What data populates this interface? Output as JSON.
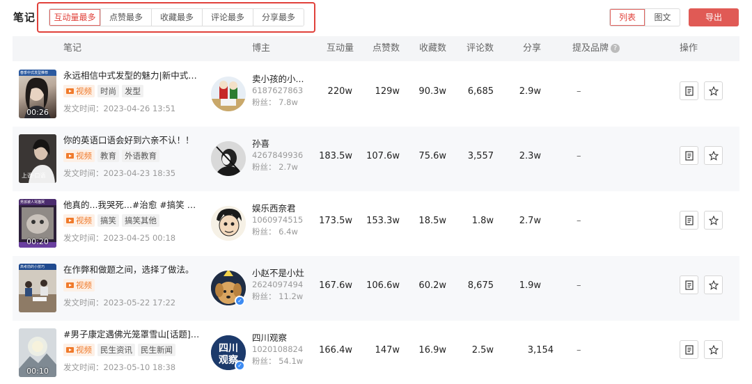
{
  "header": {
    "title": "笔记",
    "sort_tabs": [
      {
        "label": "互动量最多",
        "active": true
      },
      {
        "label": "点赞最多",
        "active": false
      },
      {
        "label": "收藏最多",
        "active": false
      },
      {
        "label": "评论最多",
        "active": false
      },
      {
        "label": "分享最多",
        "active": false
      }
    ],
    "view_toggle": [
      {
        "label": "列表",
        "active": true
      },
      {
        "label": "图文",
        "active": false
      }
    ],
    "export_label": "导出"
  },
  "columns": {
    "note": "笔记",
    "blogger": "博主",
    "interactions": "互动量",
    "likes": "点赞数",
    "collects": "收藏数",
    "comments": "评论数",
    "shares": "分享",
    "brand": "提及品牌",
    "actions": "操作"
  },
  "rows": [
    {
      "thumb_strip": "春季中式发型推荐",
      "duration": "00:26",
      "title": "永远相信中式发型的魅力|新中式发...",
      "tags": [
        "视频",
        "时尚",
        "发型"
      ],
      "post_time": "发文时间：2023-04-26 13:51",
      "blogger_name": "卖小孩的小...",
      "blogger_id": "6187627863",
      "fans": "粉丝：  7.8w",
      "verified": false,
      "interactions": "220w",
      "likes": "129w",
      "collects": "90.3w",
      "comments": "6,685",
      "shares": "2.9w",
      "brand": "–"
    },
    {
      "thumb_strip": "",
      "duration": "",
      "title": "你的英语口语会好到六亲不认！！",
      "tags": [
        "视频",
        "教育",
        "外语教育"
      ],
      "post_time": "发文时间：2023-04-23 18:35",
      "blogger_name": "孙喜",
      "blogger_id": "4267849936",
      "fans": "粉丝：  2.7w",
      "verified": false,
      "interactions": "183.5w",
      "likes": "107.6w",
      "collects": "75.6w",
      "comments": "3,557",
      "shares": "2.3w",
      "brand": "–"
    },
    {
      "thumb_strip": "男孩被人骂猫哭",
      "duration": "00:20",
      "title": "他真的...我哭死...#治愈 #搞笑 #娱...",
      "tags": [
        "视频",
        "搞笑",
        "搞笑其他"
      ],
      "post_time": "发文时间：2023-04-25 00:18",
      "blogger_name": "娱乐西奈君",
      "blogger_id": "1060974515",
      "fans": "粉丝：  6.4w",
      "verified": false,
      "interactions": "173.5w",
      "likes": "153.3w",
      "collects": "18.5w",
      "comments": "1.8w",
      "shares": "2.7w",
      "brand": "–"
    },
    {
      "thumb_strip": "高考前的小技巧",
      "duration": "",
      "title": "在作弊和做题之间，选择了做法。",
      "tags": [
        "视频"
      ],
      "post_time": "发文时间：2023-05-22 17:22",
      "blogger_name": "小赵不是小灶",
      "blogger_id": "2624097494",
      "fans": "粉丝：  11.2w",
      "verified": true,
      "interactions": "167.6w",
      "likes": "106.6w",
      "collects": "60.2w",
      "comments": "8,675",
      "shares": "1.9w",
      "brand": "–"
    },
    {
      "thumb_strip": "",
      "duration": "00:10",
      "title": "#男子康定遇佛光笼罩雪山[话题]# ...",
      "tags": [
        "视频",
        "民生资讯",
        "民生新闻"
      ],
      "post_time": "发文时间：2023-05-10 18:38",
      "blogger_name": "四川观察",
      "blogger_id": "1020108824",
      "fans": "粉丝：  54.1w",
      "verified": true,
      "interactions": "166.4w",
      "likes": "147w",
      "collects": "16.9w",
      "comments": "2.5w",
      "shares": "3,154",
      "brand": "–"
    }
  ],
  "colors": {
    "accent": "#e0403a",
    "export_bg": "#e05a55",
    "video_tag": "#f07a2b",
    "verified": "#3d8bf2"
  },
  "icons": {
    "row_actions": [
      "document-icon",
      "star-icon"
    ],
    "verified_badge": "check-icon",
    "help": "question-icon"
  }
}
